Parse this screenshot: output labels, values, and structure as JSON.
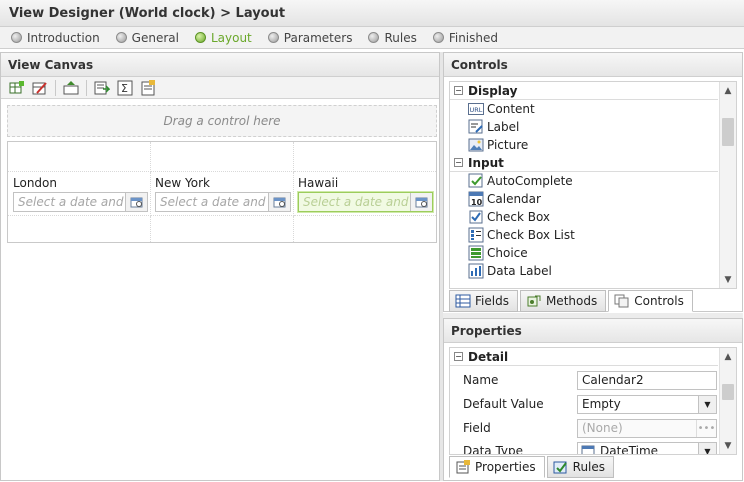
{
  "window": {
    "title": "View Designer (World clock) > Layout"
  },
  "steps": [
    {
      "label": "Introduction",
      "active": false
    },
    {
      "label": "General",
      "active": false
    },
    {
      "label": "Layout",
      "active": true
    },
    {
      "label": "Parameters",
      "active": false
    },
    {
      "label": "Rules",
      "active": false
    },
    {
      "label": "Finished",
      "active": false
    }
  ],
  "canvas": {
    "header": "View Canvas",
    "toolbar_icons": [
      "add-table-icon",
      "edit-table-icon",
      "insert-row-icon",
      "export-icon",
      "sum-icon",
      "properties-icon"
    ],
    "drop_hint": "Drag a control here",
    "cities": [
      {
        "label": "London",
        "placeholder": "Select a date and"
      },
      {
        "label": "New York",
        "placeholder": "Select a date and"
      },
      {
        "label": "Hawaii",
        "placeholder": "Select a date and"
      }
    ]
  },
  "controls": {
    "header": "Controls",
    "groups": [
      {
        "name": "Display",
        "items": [
          {
            "label": "Content",
            "icon": "url-icon"
          },
          {
            "label": "Label",
            "icon": "label-icon"
          },
          {
            "label": "Picture",
            "icon": "picture-icon"
          }
        ]
      },
      {
        "name": "Input",
        "items": [
          {
            "label": "AutoComplete",
            "icon": "autocomplete-icon"
          },
          {
            "label": "Calendar",
            "icon": "calendar-icon"
          },
          {
            "label": "Check Box",
            "icon": "checkbox-icon"
          },
          {
            "label": "Check Box List",
            "icon": "checkbox-list-icon"
          },
          {
            "label": "Choice",
            "icon": "choice-icon"
          },
          {
            "label": "Data Label",
            "icon": "data-label-icon"
          }
        ]
      }
    ],
    "tabs": [
      {
        "label": "Fields",
        "active": false
      },
      {
        "label": "Methods",
        "active": false
      },
      {
        "label": "Controls",
        "active": true
      }
    ]
  },
  "properties": {
    "header": "Properties",
    "section": "Detail",
    "rows": [
      {
        "label": "Name",
        "value": "Calendar2"
      },
      {
        "label": "Default Value",
        "value": "Empty"
      },
      {
        "label": "Field",
        "value": "(None)"
      },
      {
        "label": "Data Type",
        "value": "DateTime"
      }
    ],
    "tabs": [
      {
        "label": "Properties",
        "active": true
      },
      {
        "label": "Rules",
        "active": false
      }
    ]
  },
  "colors": {
    "accent": "#6aa82a",
    "selected_fill": "#f1fae3",
    "border": "#c8c8c8"
  }
}
